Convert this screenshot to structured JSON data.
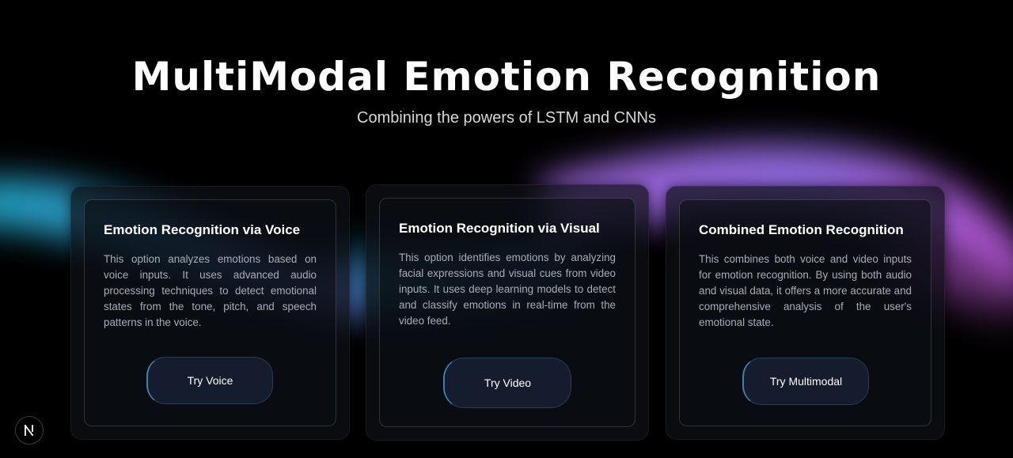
{
  "header": {
    "title": "MultiModal Emotion Recognition",
    "subtitle": "Combining the powers of LSTM and CNNs"
  },
  "cards": [
    {
      "title": "Emotion Recognition via Voice",
      "description": "This option analyzes emotions based on voice inputs. It uses advanced audio processing techniques to detect emotional states from the tone, pitch, and speech patterns in the voice.",
      "button_label": "Try Voice"
    },
    {
      "title": "Emotion Recognition via Visual",
      "description": "This option identifies emotions by analyzing facial expressions and visual cues from video inputs. It uses deep learning models to detect and classify emotions in real-time from the video feed.",
      "button_label": "Try Video"
    },
    {
      "title": "Combined Emotion Recognition",
      "description": "This combines both voice and video inputs for emotion recognition. By using both audio and visual data, it offers a more accurate and comprehensive analysis of the user's emotional state.",
      "button_label": "Try Multimodal"
    }
  ],
  "badge": {
    "icon": "nextjs-logo-icon"
  },
  "colors": {
    "background": "#000000",
    "glow_cyan": "#2ec8e6",
    "glow_purple": "#b56cf0",
    "button_bg": "#141c2d",
    "button_accent": "#3f7fb2"
  }
}
